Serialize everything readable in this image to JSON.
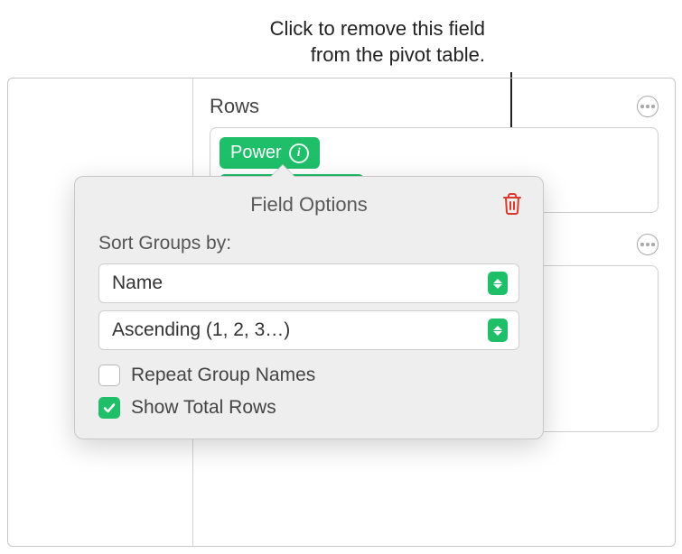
{
  "callout": {
    "line1": "Click to remove this field",
    "line2": "from the pivot table."
  },
  "panel": {
    "rows_title": "Rows",
    "field_chip": "Power"
  },
  "popover": {
    "title": "Field Options",
    "sort_label": "Sort Groups by:",
    "sort_by": "Name",
    "sort_order": "Ascending (1, 2, 3…)",
    "repeat_label": "Repeat Group Names",
    "totals_label": "Show Total Rows"
  }
}
